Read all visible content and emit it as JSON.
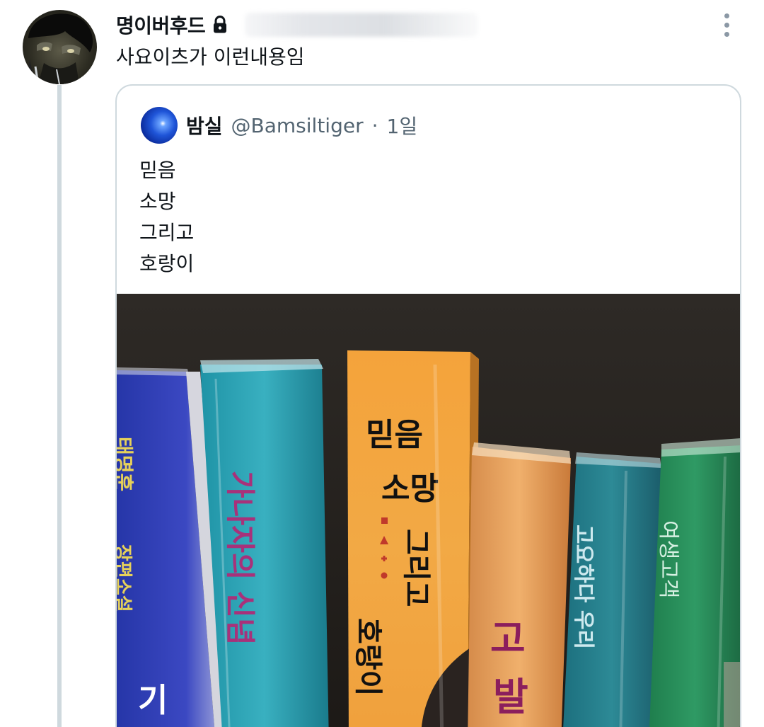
{
  "tweet": {
    "author": {
      "display_name": "명이버후드"
    },
    "text": "사요이츠가 이런내용임",
    "icons": {
      "lock": "lock-icon",
      "more": "more-icon"
    }
  },
  "quoted_tweet": {
    "author": {
      "display_name": "밤실",
      "handle": "@Bamsiltiger"
    },
    "separator": "·",
    "time": "1일",
    "lines": [
      "믿음",
      "소망",
      "그리고",
      "호랑이"
    ],
    "photo": {
      "spine_title_words": [
        "믿음",
        "소망",
        "그리고",
        "호랑이"
      ],
      "spine_text_left": [
        "태명훈",
        "장편소설",
        "기"
      ],
      "spine_text_center": [
        "가나자의 신념",
        "고",
        "발"
      ],
      "spine_text_right": [
        "고요하다 우리",
        "여생고객"
      ]
    }
  }
}
